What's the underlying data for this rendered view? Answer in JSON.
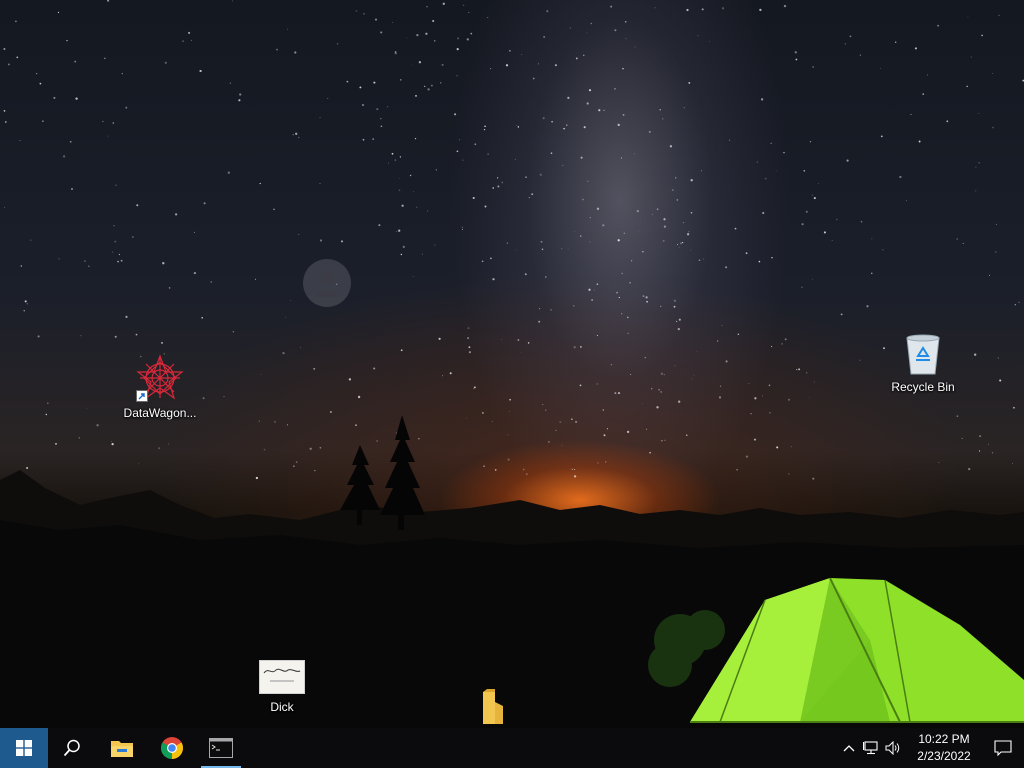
{
  "desktop": {
    "icons": [
      {
        "id": "datawagon",
        "label": "DataWagon...",
        "icon": "datawagon-logo-icon",
        "shortcut": true
      },
      {
        "id": "recycle",
        "label": "Recycle Bin",
        "icon": "recycle-bin-icon"
      },
      {
        "id": "dick",
        "label": "Dick",
        "icon": "image-thumbnail-icon"
      },
      {
        "id": "folder",
        "label": "",
        "icon": "folder-icon"
      }
    ],
    "dick_thumb_text": "Shorts"
  },
  "taskbar": {
    "start_icon": "windows-logo-icon",
    "search_icon": "search-icon",
    "pinned": [
      {
        "name": "File Explorer",
        "icon": "file-explorer-icon"
      },
      {
        "name": "Google Chrome",
        "icon": "chrome-icon"
      },
      {
        "name": "Command Prompt",
        "icon": "terminal-icon",
        "active": true
      }
    ],
    "tray": {
      "chevron_icon": "chevron-up-icon",
      "network_icon": "network-icon",
      "volume_icon": "volume-icon",
      "time": "10:22 PM",
      "date": "2/23/2022",
      "action_center_icon": "notification-icon"
    }
  },
  "colors": {
    "taskbar_bg": "#0b0b0d",
    "start_bg": "#1f5a8e",
    "tent_green": "#8fe028",
    "accent": "#76b9ed"
  }
}
